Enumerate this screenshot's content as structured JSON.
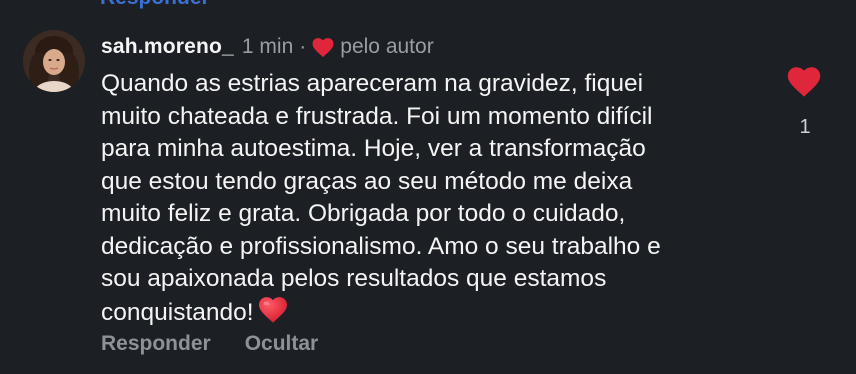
{
  "previous_comment": {
    "action_label": "Responder"
  },
  "comment": {
    "username": "sah.moreno_",
    "time": "1 min",
    "separator": "·",
    "liked_by_author_label": "pelo autor",
    "text": "Quando as estrias apareceram na gravidez, fiquei\nmuito chateada e frustrada. Foi um momento difícil\npara minha autoestima. Hoje, ver a transformação\nque estou tendo graças ao seu método  me deixa\nmuito feliz e grata. Obrigada por todo o cuidado,\ndedicação e profissionalismo. Amo o seu trabalho e\nsou apaixonada pelos resultados que estamos\nconquistando!",
    "like_count": "1",
    "like_icon": "heart-filled-icon",
    "actions": {
      "reply": "Responder",
      "hide": "Ocultar"
    }
  },
  "colors": {
    "background": "#1c1f24",
    "heart_red": "#e0263a",
    "muted_text": "#9a9da3",
    "primary_text": "#f4f4f4"
  }
}
